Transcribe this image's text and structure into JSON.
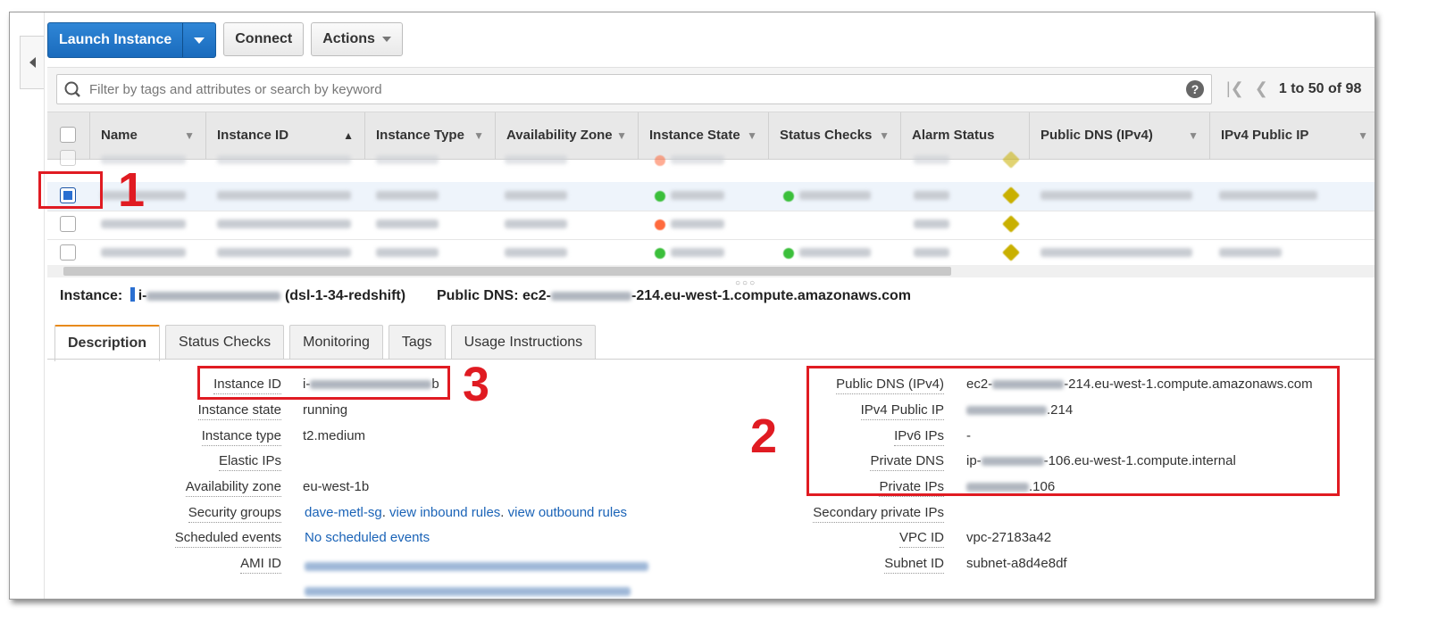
{
  "toolbar": {
    "launch_label": "Launch Instance",
    "connect_label": "Connect",
    "actions_label": "Actions"
  },
  "filter": {
    "placeholder": "Filter by tags and attributes or search by keyword",
    "help": "?"
  },
  "pager": {
    "range": "1 to 50 of 98"
  },
  "table": {
    "columns": [
      "Name",
      "Instance ID",
      "Instance Type",
      "Availability Zone",
      "Instance State",
      "Status Checks",
      "Alarm Status",
      "Public DNS (IPv4)",
      "IPv4 Public IP"
    ],
    "row_states": [
      "stopped",
      "running",
      "stopped",
      "running"
    ],
    "selected_row": 2
  },
  "summary": {
    "instance_label": "Instance:",
    "instance_prefix": "i-",
    "instance_name": "(dsl-1-34-redshift)",
    "public_dns_label": "Public DNS:",
    "public_dns_prefix": "ec2-",
    "public_dns_suffix": "-214.eu-west-1.compute.amazonaws.com"
  },
  "tabs": [
    "Description",
    "Status Checks",
    "Monitoring",
    "Tags",
    "Usage Instructions"
  ],
  "description": {
    "left": [
      {
        "label": "Instance ID",
        "value_prefix": "i-",
        "value_suffix": "b"
      },
      {
        "label": "Instance state",
        "value": "running"
      },
      {
        "label": "Instance type",
        "value": "t2.medium"
      },
      {
        "label": "Elastic IPs",
        "value": ""
      },
      {
        "label": "Availability zone",
        "value": "eu-west-1b"
      },
      {
        "label": "Security groups",
        "links": [
          "dave-metl-sg",
          "view inbound rules",
          "view outbound rules"
        ]
      },
      {
        "label": "Scheduled events",
        "link": "No scheduled events"
      },
      {
        "label": "AMI ID",
        "value": ""
      }
    ],
    "right": [
      {
        "label": "Public DNS (IPv4)",
        "value_prefix": "ec2-",
        "value_suffix": "-214.eu-west-1.compute.amazonaws.com"
      },
      {
        "label": "IPv4 Public IP",
        "value_suffix": ".214"
      },
      {
        "label": "IPv6 IPs",
        "value": "-"
      },
      {
        "label": "Private DNS",
        "value_prefix": "ip-",
        "value_suffix": "-106.eu-west-1.compute.internal"
      },
      {
        "label": "Private IPs",
        "value_suffix": ".106"
      },
      {
        "label": "Secondary private IPs",
        "value": ""
      },
      {
        "label": "VPC ID",
        "value": "vpc-27183a42"
      },
      {
        "label": "Subnet ID",
        "value": "subnet-a8d4e8df"
      }
    ]
  },
  "annotations": {
    "one": "1",
    "two": "2",
    "three": "3"
  },
  "colors": {
    "primary": "#1a6bbd",
    "annotation": "#e01b22",
    "link": "#1a63b7",
    "running": "#3bbf3b",
    "stopped": "#ff6a3d"
  }
}
